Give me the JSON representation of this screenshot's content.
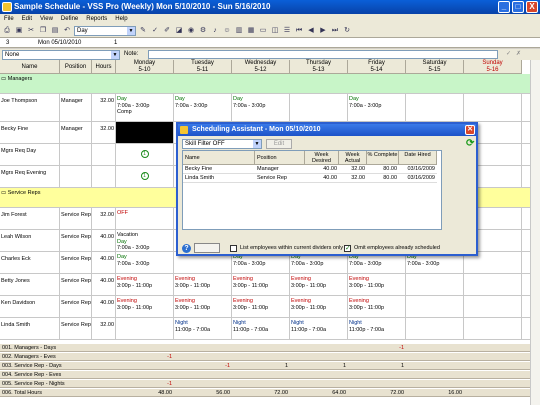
{
  "app": {
    "title": "Sample Schedule - VSS Pro (Weekly) Mon 5/10/2010 - Sun 5/16/2010",
    "min": "_",
    "max": "□",
    "close": "X"
  },
  "menu": [
    "File",
    "Edit",
    "View",
    "Define",
    "Reports",
    "Help"
  ],
  "toolbar": {
    "period": "Day"
  },
  "infobar": {
    "count": "3",
    "date": "Mon 05/10/2010",
    "value": "1"
  },
  "filterbar": {
    "filter": "None",
    "note_label": "Note:"
  },
  "columns": {
    "name": "Name",
    "position": "Position",
    "hours": "Hours"
  },
  "days": [
    {
      "dow": "Monday",
      "date": "5-10"
    },
    {
      "dow": "Tuesday",
      "date": "5-11"
    },
    {
      "dow": "Wednesday",
      "date": "5-12"
    },
    {
      "dow": "Thursday",
      "date": "5-13"
    },
    {
      "dow": "Friday",
      "date": "5-14"
    },
    {
      "dow": "Saturday",
      "date": "5-15"
    },
    {
      "dow": "Sunday",
      "date": "5-16"
    }
  ],
  "groups": {
    "managers": "Managers",
    "service": "Service Reps"
  },
  "employees": [
    {
      "name": "Joe Thompson",
      "position": "Manager",
      "hours": "32.00",
      "mon1": "Day",
      "mon2": "7:00a - 3:00p",
      "mon3": "Comp",
      "tue1": "Day",
      "tue2": "7:00a - 3:00p",
      "wed1": "Day",
      "wed2": "7:00a - 3:00p",
      "fri1": "Day",
      "fri2": "7:00a - 3:00p"
    },
    {
      "name": "Becky Fine",
      "position": "Manager",
      "hours": "32.00"
    },
    {
      "name": "Mgrs Req Day",
      "badge": "1"
    },
    {
      "name": "Mgrs Req Evening",
      "badge": "1"
    },
    {
      "name": "Jim Forest",
      "position": "Service Rep",
      "hours": "32.00",
      "mon1": "OFF"
    },
    {
      "name": "Leah Wilson",
      "position": "Service Rep",
      "hours": "40.00",
      "mon1": "Vacation",
      "mon2": "Day",
      "mon3": "7:00a - 3:00p"
    },
    {
      "name": "Charles Eck",
      "position": "Service Rep",
      "hours": "40.00",
      "mon1": "Day",
      "mon2": "7:00a - 3:00p",
      "wed1": "Day",
      "wed2": "7:00a - 3:00p",
      "thu1": "Day",
      "thu2": "7:00a - 3:00p",
      "fri1": "Day",
      "fri2": "7:00a - 3:00p",
      "sat1": "Day",
      "sat2": "7:00a - 3:00p"
    },
    {
      "name": "Betty Jones",
      "position": "Service Rep",
      "hours": "40.00",
      "mon1": "Evening",
      "mon2": "3:00p - 11:00p",
      "tue1": "Evening",
      "tue2": "3:00p - 11:00p",
      "wed1": "Evening",
      "wed2": "3:00p - 11:00p",
      "thu1": "Evening",
      "thu2": "3:00p - 11:00p",
      "fri1": "Evening",
      "fri2": "3:00p - 11:00p"
    },
    {
      "name": "Ken Davidson",
      "position": "Service Rep",
      "hours": "40.00",
      "mon1": "Evening",
      "mon2": "3:00p - 11:00p",
      "tue1": "Evening",
      "tue2": "3:00p - 11:00p",
      "wed1": "Evening",
      "wed2": "3:00p - 11:00p",
      "thu1": "Evening",
      "thu2": "3:00p - 11:00p",
      "fri1": "Evening",
      "fri2": "3:00p - 11:00p"
    },
    {
      "name": "Linda Smith",
      "position": "Service Rep",
      "hours": "32.00",
      "tue1": "Night",
      "tue2": "11:00p - 7:00a",
      "wed1": "Night",
      "wed2": "11:00p - 7:00a",
      "thu1": "Night",
      "thu2": "11:00p - 7:00a",
      "fri1": "Night",
      "fri2": "11:00p - 7:00a"
    }
  ],
  "summary": [
    {
      "label": "001. Managers - Days",
      "fri": "-1"
    },
    {
      "label": "002. Managers - Eves",
      "mon": "-1"
    },
    {
      "label": "003. Service Rep - Days",
      "tue": "-1",
      "wed": "1",
      "thu": "1",
      "fri": "1"
    },
    {
      "label": "004. Service Rep - Eves"
    },
    {
      "label": "005. Service Rep - Nights",
      "mon": "-1"
    },
    {
      "label": "006. Total Hours",
      "mon": "48.00",
      "tue": "56.00",
      "wed": "72.00",
      "thu": "64.00",
      "fri": "72.00",
      "sat": "16.00"
    }
  ],
  "dialog": {
    "title": "Scheduling Assistant - Mon 05/10/2010",
    "skill_filter": "Skill Filter OFF",
    "edit": "Edit",
    "headers": [
      "Name",
      "Position",
      "Week Desired",
      "Week Actual",
      "% Complete",
      "Date Hired"
    ],
    "rows": [
      [
        "Becky Fine",
        "Manager",
        "40.00",
        "32.00",
        "80.00",
        "03/16/2009"
      ],
      [
        "Linda Smith",
        "Service Rep",
        "40.00",
        "32.00",
        "80.00",
        "03/16/2009"
      ]
    ],
    "opt1": "List employees within current dividers only",
    "opt2": "Omit employees already scheduled"
  },
  "colors": {
    "managers_row": "#c8f5c8",
    "service_row": "#ffff9c",
    "title": "#0a5fd8"
  }
}
